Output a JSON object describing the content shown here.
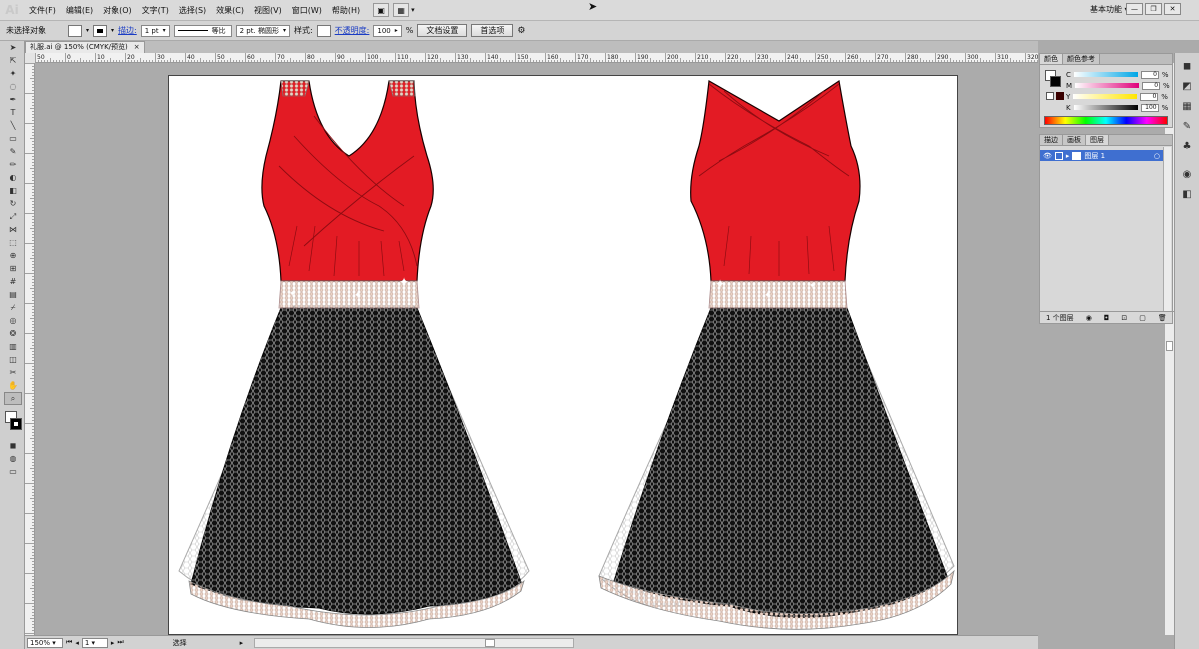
{
  "app": {
    "logo": "Ai",
    "workspace": "基本功能"
  },
  "menu": [
    "文件(F)",
    "编辑(E)",
    "对象(O)",
    "文字(T)",
    "选择(S)",
    "效果(C)",
    "视图(V)",
    "窗口(W)",
    "帮助(H)"
  ],
  "control": {
    "selection": "未选择对象",
    "stroke_label": "描边:",
    "stroke_weight": "1 pt",
    "profile": "等比",
    "brush": "2 pt. 椭圆形",
    "style_label": "样式:",
    "opacity_label": "不透明度:",
    "opacity_value": "100",
    "opacity_unit": "%",
    "doc_setup": "文档设置",
    "preferences": "首选项"
  },
  "document": {
    "tab": "礼服.ai @ 150% (CMYK/预览)",
    "close": "×"
  },
  "ruler_labels": [
    "50",
    "0",
    "10",
    "20",
    "30",
    "40",
    "50",
    "60",
    "70",
    "80",
    "90",
    "100",
    "110",
    "120",
    "130",
    "140",
    "150",
    "160",
    "170",
    "180",
    "190",
    "200",
    "210",
    "220",
    "230",
    "240",
    "250",
    "260",
    "270",
    "280",
    "290",
    "300",
    "310",
    "320"
  ],
  "status": {
    "zoom": "150%",
    "page": "1",
    "tool": "选择"
  },
  "panels": {
    "color": {
      "tabs": [
        "颜色",
        "颜色参考"
      ],
      "channels": [
        {
          "label": "C",
          "value": "0"
        },
        {
          "label": "M",
          "value": "0"
        },
        {
          "label": "Y",
          "value": "0"
        },
        {
          "label": "K",
          "value": "100"
        }
      ],
      "unit": "%"
    },
    "layers": {
      "tabs": [
        "描边",
        "画板",
        "图层"
      ],
      "layer_name": "图层 1",
      "count": "1 个图层"
    }
  },
  "colors": {
    "dress_red": "#e31b24",
    "skirt_black": "#111111",
    "belt": "#d9b9a8"
  }
}
